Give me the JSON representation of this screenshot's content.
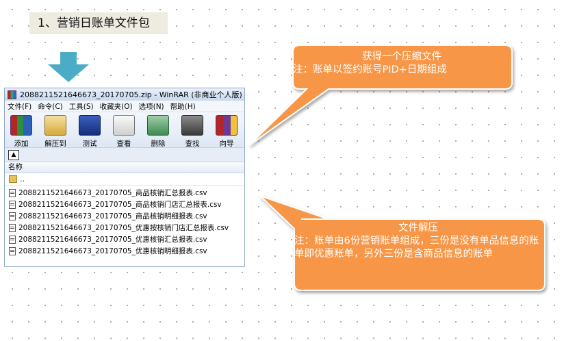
{
  "slide": {
    "heading": "1、营销日账单文件包"
  },
  "winrar": {
    "title": "20882115216466​73_20170705.zip - WinRAR (非商业个人版)",
    "menu": [
      "文件(F)",
      "命令(C)",
      "工具(S)",
      "收藏夹(O)",
      "选项(N)",
      "帮助(H)"
    ],
    "toolbar": [
      {
        "label": "添加",
        "icon": "archive-add-icon"
      },
      {
        "label": "解压到",
        "icon": "extract-to-icon"
      },
      {
        "label": "测试",
        "icon": "test-archive-icon"
      },
      {
        "label": "查看",
        "icon": "view-glasses-icon"
      },
      {
        "label": "删除",
        "icon": "delete-recycle-icon"
      },
      {
        "label": "查找",
        "icon": "find-binoculars-icon"
      },
      {
        "label": "向导",
        "icon": "wizard-icon"
      }
    ],
    "column_name": "名称",
    "parent_dir": "..",
    "files": [
      "2088211521646673_20170705_商品核销汇总报表.csv",
      "2088211521646673_20170705_商品核销门店汇总报表.csv",
      "2088211521646673_20170705_商品核销明细报表.csv",
      "2088211521646673_20170705_优惠按核销门店汇总报表.csv",
      "2088211521646673_20170705_优惠核销汇总报表.csv",
      "2088211521646673_20170705_优惠核销明细报表.csv"
    ]
  },
  "callouts": {
    "top": {
      "title": "获得一个压缩文件",
      "note": "注：账单以签约账号PID+日期组成"
    },
    "bottom": {
      "title": "文件解压",
      "note": "注：账单由6份营销账单组成，三份是没有单品信息的账单即优惠账单，另外三份是含商品信息的账单"
    }
  },
  "colors": {
    "callout_fill": "#f79646",
    "callout_border": "#ffffff",
    "arrow_fill": "#4bacc6"
  }
}
